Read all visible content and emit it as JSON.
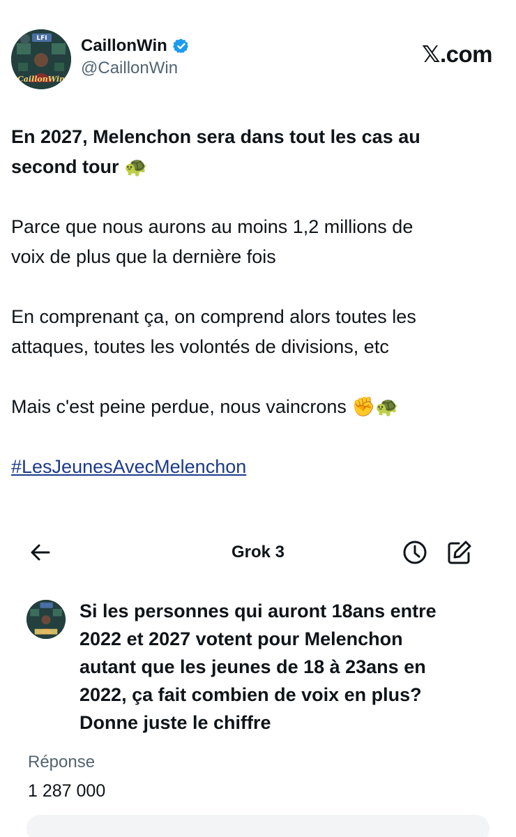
{
  "tweet_header": {
    "display_name": "CaillonWin",
    "handle": "@CaillonWin",
    "site_label": "𝕏.com",
    "avatar_text": "CaillonWin",
    "avatar_badge": "LFI"
  },
  "tweet": {
    "line_1": "En 2027, Melenchon sera dans tout les cas au",
    "line_2": "second tour",
    "line_2_emoji": "🐢",
    "para_2_line_1": "Parce que nous aurons au moins 1,2 millions de",
    "para_2_line_2": "voix de plus que la dernière fois",
    "para_3_line_1": "En comprenant ça, on comprend alors toutes les",
    "para_3_line_2": "attaques, toutes les volontés de divisions, etc",
    "para_4": "Mais c'est peine perdue, nous vaincrons",
    "para_4_emoji": "✊🐢",
    "hashtag": "#LesJeunesAvecMelenchon"
  },
  "grok": {
    "title": "Grok 3",
    "question_line_1": "Si les personnes qui auront 18ans entre",
    "question_line_2": "2022 et 2027 votent pour Melenchon",
    "question_line_3": "autant que les jeunes de 18 à 23ans en",
    "question_line_4": "2022, ça fait combien de voix en plus?",
    "question_line_5": "Donne juste le chiffre",
    "answer_label": "Réponse",
    "answer_value": "1 287 000"
  },
  "colors": {
    "text": "#0f1419",
    "secondary": "#536471",
    "verified": "#1d9bf0",
    "hashtag": "#1d3a8a"
  }
}
